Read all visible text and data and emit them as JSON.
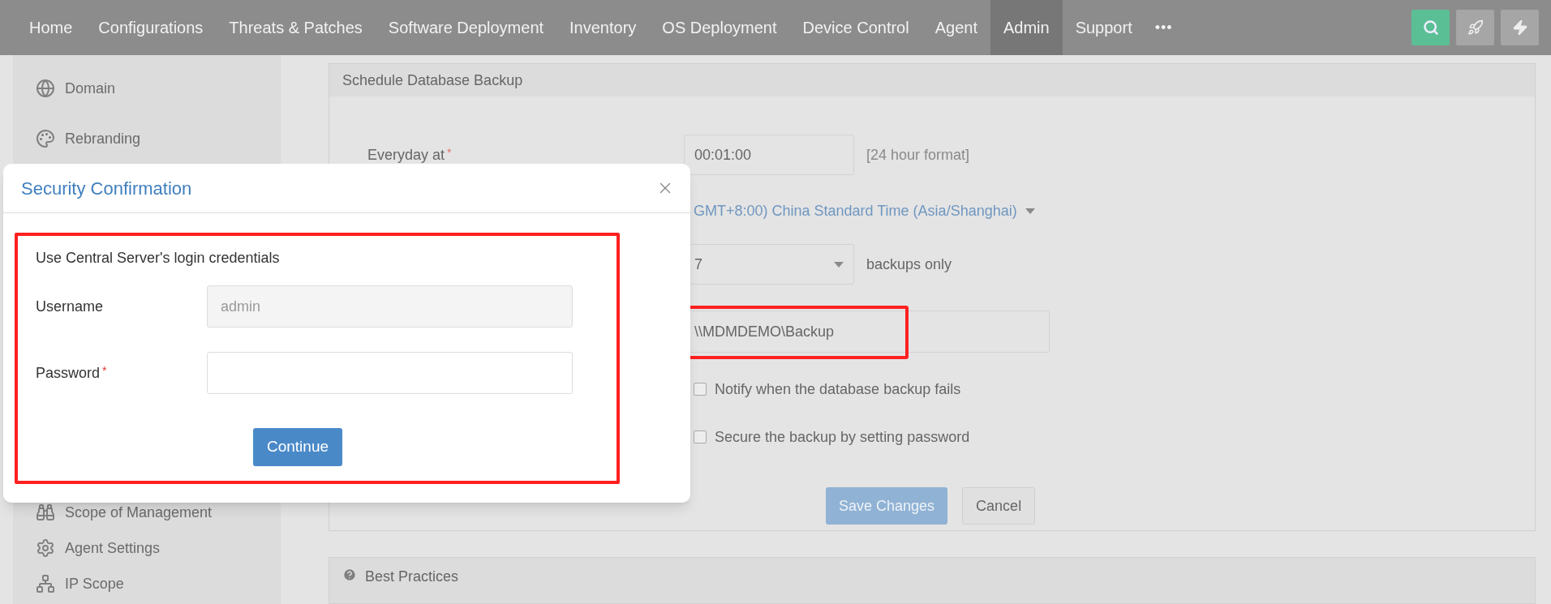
{
  "nav": {
    "items": [
      {
        "label": "Home",
        "selected": false
      },
      {
        "label": "Configurations",
        "selected": false
      },
      {
        "label": "Threats & Patches",
        "selected": false
      },
      {
        "label": "Software Deployment",
        "selected": false
      },
      {
        "label": "Inventory",
        "selected": false
      },
      {
        "label": "OS Deployment",
        "selected": false
      },
      {
        "label": "Device Control",
        "selected": false
      },
      {
        "label": "Agent",
        "selected": false
      },
      {
        "label": "Admin",
        "selected": true
      },
      {
        "label": "Support",
        "selected": false
      }
    ],
    "more": "•••"
  },
  "sidebar": {
    "top_items": [
      {
        "label": "Domain"
      },
      {
        "label": "Rebranding"
      }
    ],
    "bottom_items": [
      {
        "label": "Scope of Management"
      },
      {
        "label": "Agent Settings"
      },
      {
        "label": "IP Scope"
      }
    ]
  },
  "panel": {
    "title": "Schedule Database Backup",
    "time": {
      "label": "Everyday at",
      "required_mark": "*",
      "value": "00:01:00",
      "hint": "[24 hour format]"
    },
    "timezone": "GMT+8:00) China Standard Time (Asia/Shanghai)",
    "retain": {
      "value": "7",
      "suffix": "backups only"
    },
    "path": {
      "value": "\\\\MDMDEMO\\Backup"
    },
    "checkboxes": [
      {
        "label": "Notify when the database backup fails",
        "checked": false
      },
      {
        "label": "Secure the backup by setting password",
        "checked": false
      }
    ],
    "buttons": {
      "save": "Save Changes",
      "cancel": "Cancel"
    }
  },
  "best_practices": {
    "title": "Best Practices"
  },
  "dialog": {
    "title": "Security Confirmation",
    "intro": "Use Central Server's login credentials",
    "username": {
      "label": "Username",
      "value": "admin",
      "disabled": true
    },
    "password": {
      "label": "Password",
      "required_mark": "*"
    },
    "button": "Continue"
  }
}
